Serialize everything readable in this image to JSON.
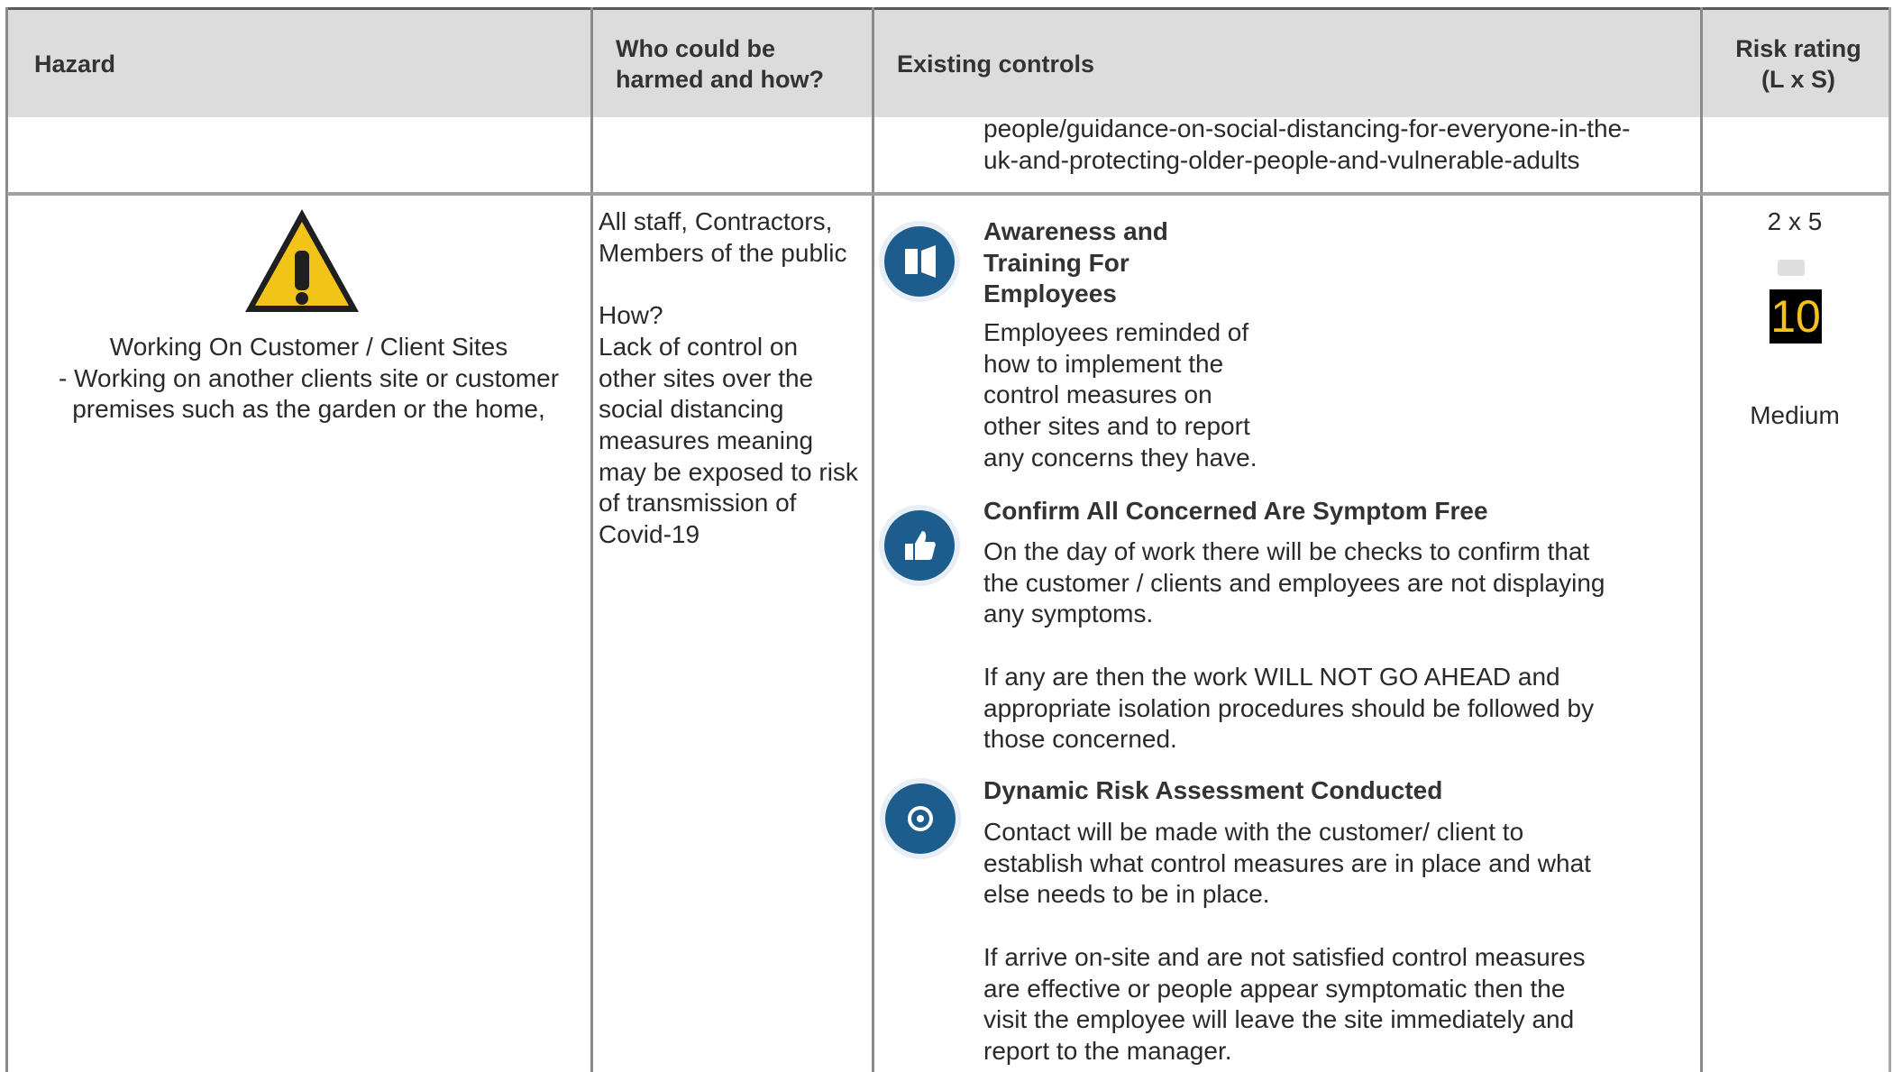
{
  "header": {
    "hazard": "Hazard",
    "who": "Who could be\nharmed and how?",
    "controls": "Existing controls",
    "risk": "Risk rating\n(L x S)"
  },
  "carryover": {
    "controls_text": "people/guidance-on-social-distancing-for-everyone-in-the-\nuk-and-protecting-older-people-and-vulnerable-adults"
  },
  "row": {
    "hazard_text": "Working On Customer / Client Sites\n- Working on another clients site or customer\npremises such as the garden or the home,",
    "hazard_icon": "warning-icon",
    "who_text": "All staff, Contractors,\nMembers of the public\n\nHow?\nLack of control on\nother sites over the\nsocial distancing\nmeasures meaning\nmay be exposed to risk\nof transmission of\nCovid-19",
    "controls": [
      {
        "title": "Awareness and\nTraining For\nEmployees",
        "body": "Employees reminded of\nhow to implement the\ncontrol measures on\nother sites and to report\nany concerns they have.",
        "icon": "training-icon"
      },
      {
        "title": "Confirm All Concerned Are Symptom Free",
        "body": "On the day of work there will be checks to confirm that\nthe customer / clients and employees are not displaying\nany symptoms.\n\nIf any are then the work WILL NOT GO AHEAD and\nappropriate isolation procedures should be followed by\nthose concerned.",
        "icon": "thumbs-up-icon"
      },
      {
        "title": "Dynamic Risk Assessment Conducted",
        "body": "Contact will be made with the customer/ client to\nestablish what control measures are in place and what\nelse needs to be in place.\n\nIf arrive on-site and are not satisfied control measures\nare effective or people appear symptomatic then the\nvisit the employee will leave the site immediately and\nreport to the manager.",
        "icon": "assessment-icon"
      }
    ],
    "risk": {
      "lxs": "2 x 5",
      "score": "10",
      "level": "Medium",
      "score_color": "#f4c21a"
    }
  }
}
